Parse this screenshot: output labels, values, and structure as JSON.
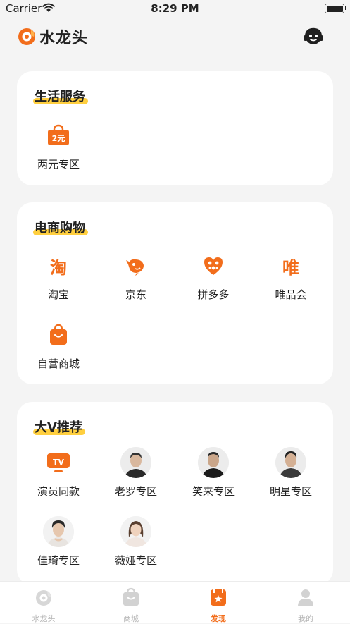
{
  "status_bar": {
    "carrier": "Carrier",
    "time": "8:29 PM"
  },
  "header": {
    "app_name": "水龙头"
  },
  "sections": {
    "life": {
      "title": "生活服务",
      "items": [
        {
          "label": "两元专区",
          "badge": "2元"
        }
      ]
    },
    "shopping": {
      "title": "电商购物",
      "items": [
        {
          "label": "淘宝",
          "glyph": "淘"
        },
        {
          "label": "京东"
        },
        {
          "label": "拼多多"
        },
        {
          "label": "唯品会",
          "glyph": "唯"
        },
        {
          "label": "自营商城"
        }
      ]
    },
    "influencer": {
      "title": "大V推荐",
      "items": [
        {
          "label": "演员同款",
          "badge": "TV"
        },
        {
          "label": "老罗专区"
        },
        {
          "label": "笑来专区"
        },
        {
          "label": "明星专区"
        },
        {
          "label": "佳琦专区"
        },
        {
          "label": "薇娅专区"
        }
      ]
    }
  },
  "tabbar": {
    "tabs": [
      {
        "label": "水龙头"
      },
      {
        "label": "商城"
      },
      {
        "label": "发现"
      },
      {
        "label": "我的"
      }
    ],
    "active_index": 2
  },
  "colors": {
    "accent": "#f26d1b",
    "highlight": "#ffcf3f",
    "background": "#f4f4f4"
  }
}
